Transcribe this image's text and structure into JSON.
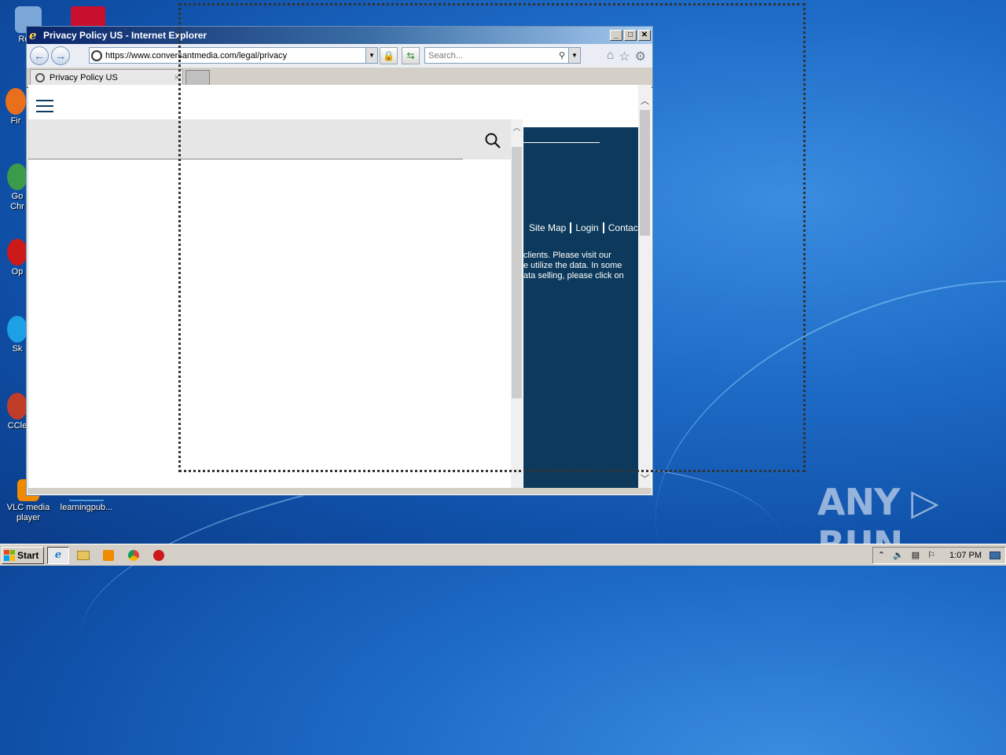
{
  "window": {
    "title": "Privacy Policy US - Internet Explorer",
    "min_label": "_",
    "max_label": "□",
    "close_label": "✕"
  },
  "navbar": {
    "back_label": "←",
    "forward_label": "→",
    "address": "https://www.conversantmedia.com/legal/privacy",
    "search_placeholder": "Search..."
  },
  "tabs": [
    {
      "label": "Privacy Policy US",
      "close": "×"
    }
  ],
  "page": {
    "footer_links": [
      "Site Map",
      "Login",
      "Contact"
    ],
    "partial_text": [
      "clients. Please visit our",
      "e utilize the data. In some",
      "ata selling, please click on"
    ]
  },
  "desktop_icons": [
    {
      "label": "Recy",
      "color": "#7aa7d8"
    },
    {
      "label": "Fir",
      "color": "#e8701c"
    },
    {
      "label": "Go\nChr",
      "color": "#3a9b4a"
    },
    {
      "label": "Op",
      "color": "#cc1a1a"
    },
    {
      "label": "Sk",
      "color": "#1ea0e6"
    },
    {
      "label": "CCle",
      "color": "#c23c2a"
    },
    {
      "label": "VLC media player",
      "color": "#f08a00"
    },
    {
      "label": "learningpub...",
      "color": "#4e9ad6"
    }
  ],
  "taskbar": {
    "start_label": "Start",
    "clock": "1:07 PM"
  },
  "watermark": "ANY ▷ RUN"
}
